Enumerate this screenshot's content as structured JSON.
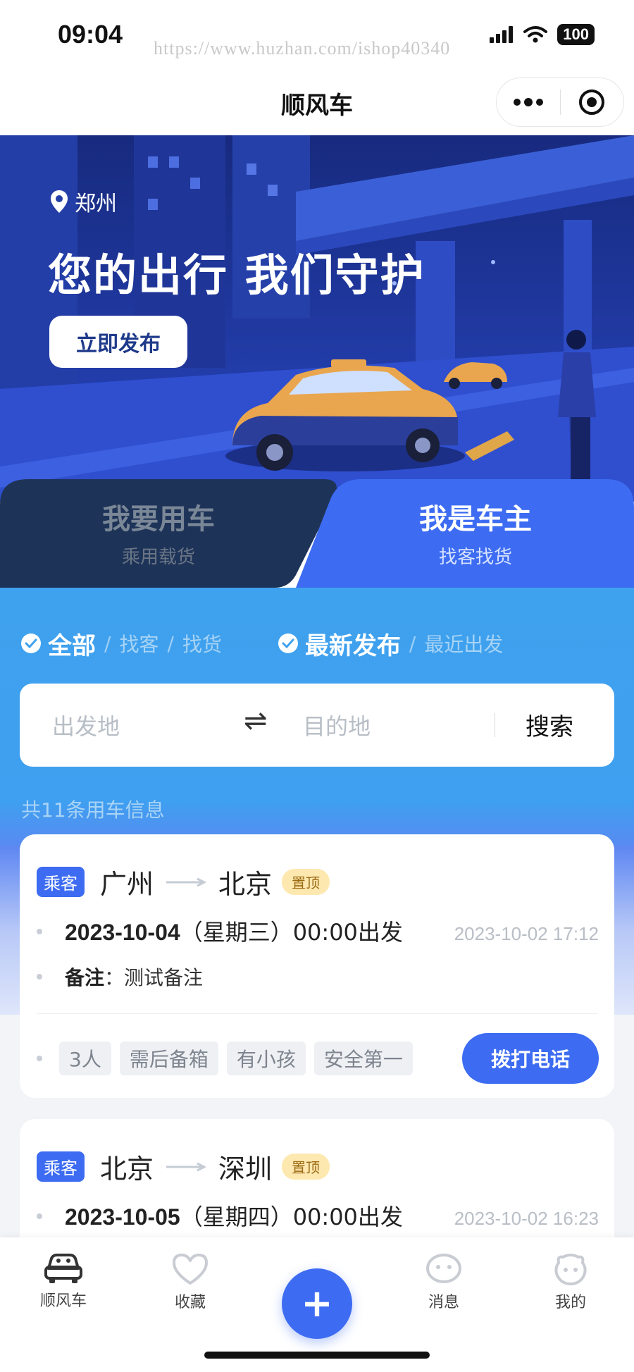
{
  "status_bar": {
    "time": "09:04",
    "watermark": "https://www.huzhan.com/ishop40340",
    "battery": "100"
  },
  "nav": {
    "title": "顺风车"
  },
  "banner": {
    "location": "郑州",
    "slogan": "您的出行 我们守护",
    "publish_button": "立即发布"
  },
  "role_tabs": [
    {
      "main": "我要用车",
      "sub": "乘用载货",
      "active": false
    },
    {
      "main": "我是车主",
      "sub": "找客找货",
      "active": true
    }
  ],
  "filters": {
    "type": {
      "active": "全部",
      "options": [
        "找客",
        "找货"
      ]
    },
    "sort": {
      "active": "最新发布",
      "options": [
        "最近出发"
      ]
    },
    "separator": "/"
  },
  "search": {
    "from_placeholder": "出发地",
    "swap_symbol": "⇌",
    "to_placeholder": "目的地",
    "button": "搜索"
  },
  "count_text": "共11条用车信息",
  "trips": [
    {
      "type_badge": "乘客",
      "from": "广州",
      "to": "北京",
      "top_badge": "置顶",
      "date": "2023-10-04",
      "date_suffix": "（星期三）00:00出发",
      "posted": "2023-10-02 17:12",
      "note_label": "备注",
      "note": "：测试备注",
      "tags": [
        "3人",
        "需后备箱",
        "有小孩",
        "安全第一"
      ],
      "call_button": "拨打电话"
    },
    {
      "type_badge": "乘客",
      "from": "北京",
      "to": "深圳",
      "top_badge": "置顶",
      "date": "2023-10-05",
      "date_suffix": "（星期四）00:00出发",
      "posted": "2023-10-02 16:23"
    }
  ],
  "tab_bar": {
    "items": [
      "顺风车",
      "收藏",
      "消息",
      "我的"
    ],
    "plus_symbol": "+"
  },
  "colors": {
    "primary": "#3d6cf2",
    "filter_bg": "#3fa2ee",
    "banner_bg": "#233fb0",
    "role_tab_dark": "#1e3358"
  }
}
